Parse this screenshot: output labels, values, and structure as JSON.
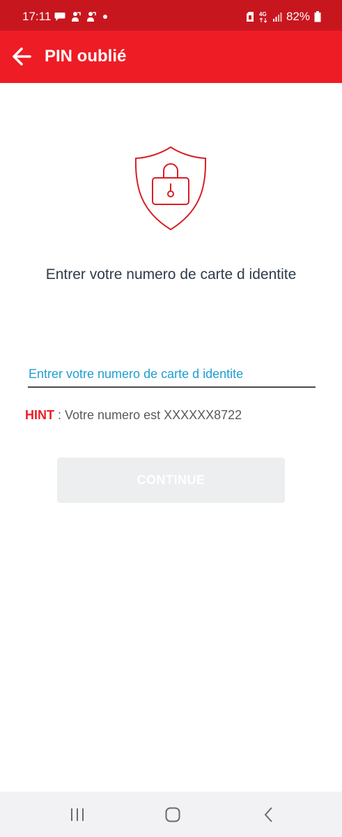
{
  "status_bar": {
    "time": "17:11",
    "battery": "82%",
    "network": "4G",
    "icons_left": [
      "chat-bubble-icon",
      "person-icon",
      "person-icon",
      "dot-icon"
    ],
    "icons_right": [
      "sim-icon",
      "network-4g-icon",
      "signal-icon",
      "battery-icon"
    ]
  },
  "app_bar": {
    "title": "PIN oublié",
    "back_icon": "arrow-back-icon"
  },
  "main": {
    "illustration": "shield-lock-icon",
    "prompt": "Entrer votre numero de carte d identite",
    "id_field": {
      "placeholder": "Entrer votre numero de carte d identite",
      "value": ""
    },
    "hint": {
      "label": "HINT",
      "separator": " : ",
      "text": "Votre numero est XXXXXX8722"
    },
    "continue_button": "CONTINUE"
  },
  "nav_bar": {
    "items": [
      "recents-icon",
      "home-icon",
      "back-icon"
    ]
  },
  "colors": {
    "status_bar": "#c8161f",
    "app_bar": "#ee1c25",
    "accent_blue": "#1f9ed0",
    "hint_red": "#ee1c25",
    "button_disabled": "#eceeef"
  }
}
